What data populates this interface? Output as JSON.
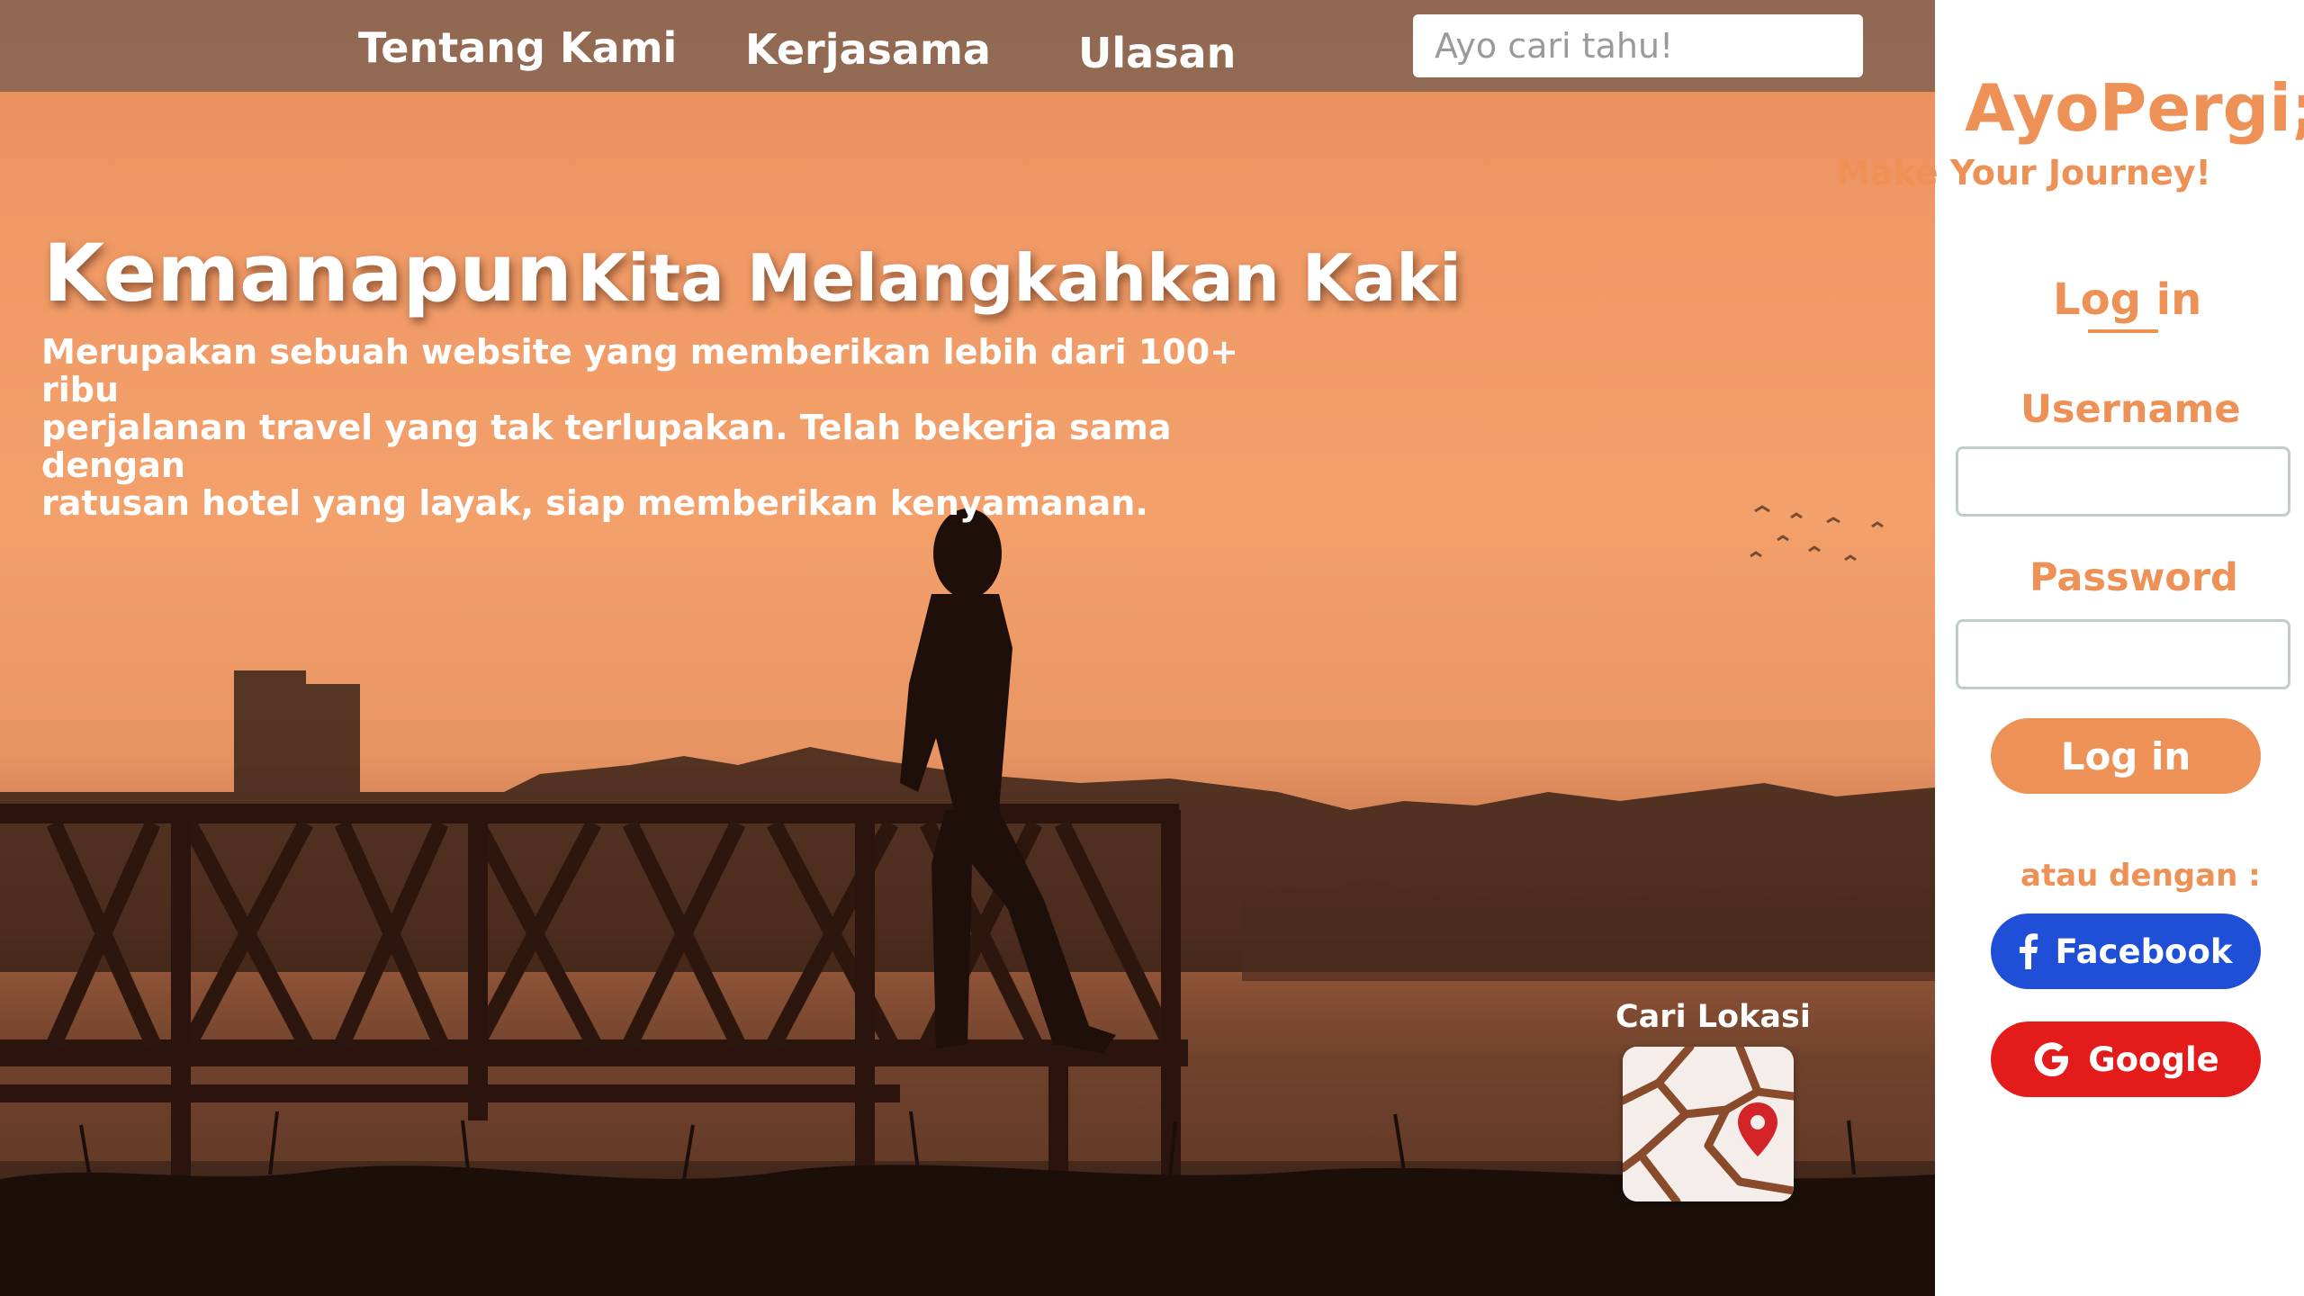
{
  "nav": {
    "links": [
      "Tentang Kami",
      "Kerjasama",
      "Ulasan"
    ],
    "search_placeholder": "Ayo cari tahu!"
  },
  "hero": {
    "headline_big": "Kemanapun",
    "headline_rest": "Kita Melangkahkan Kaki",
    "description": "Merupakan sebuah website yang memberikan lebih dari 100+ ribu\nperjalanan  travel yang tak terlupakan. Telah bekerja sama dengan\nratusan hotel yang layak, siap memberikan kenyamanan.",
    "map_label": "Cari Lokasi",
    "map_icon": "map-pin-icon"
  },
  "panel": {
    "brand": "AyoPergi;",
    "tagline": "Make Your Journey!",
    "login_title": "Log in",
    "username_label": "Username",
    "username_value": "",
    "password_label": "Password",
    "password_value": "",
    "login_button": "Log in",
    "or_text": "atau dengan :",
    "facebook_button": "Facebook",
    "google_button": "Google"
  },
  "colors": {
    "accent": "#ee9156",
    "facebook": "#1f4fd6",
    "google": "#e31b1b",
    "navbar": "#785f50"
  }
}
